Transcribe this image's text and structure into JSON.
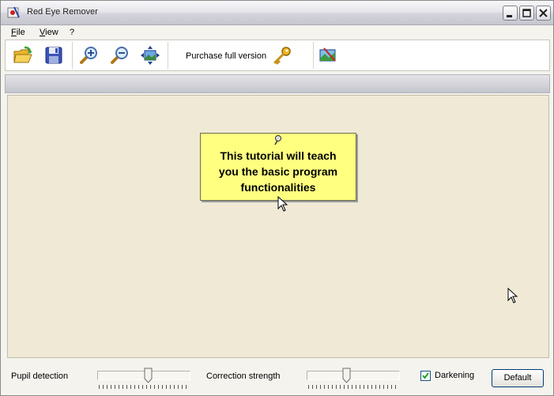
{
  "window": {
    "title": "Red Eye Remover"
  },
  "menu": {
    "items": [
      {
        "label": "File",
        "accel": "F",
        "rest": "ile"
      },
      {
        "label": "View",
        "accel": "V",
        "rest": "iew"
      },
      {
        "label": "?"
      }
    ]
  },
  "toolbar": {
    "buttons": [
      {
        "icon": "open-folder-icon"
      },
      {
        "icon": "save-disk-icon"
      },
      {
        "icon": "zoom-in-icon"
      },
      {
        "icon": "zoom-out-icon"
      },
      {
        "icon": "fit-to-window-icon"
      },
      {
        "icon": "key-icon"
      },
      {
        "icon": "edit-image-icon"
      }
    ],
    "purchase_label": "Purchase full version"
  },
  "tooltip": {
    "lines": [
      "This tutorial will teach",
      "you the basic program",
      "functionalities"
    ]
  },
  "controls": {
    "pupil_detection": {
      "label": "Pupil detection",
      "value": 0.55
    },
    "correction_strength": {
      "label": "Correction strength",
      "value": 0.42
    },
    "darkening": {
      "label": "Darkening",
      "checked": true
    },
    "default_button": "Default"
  }
}
